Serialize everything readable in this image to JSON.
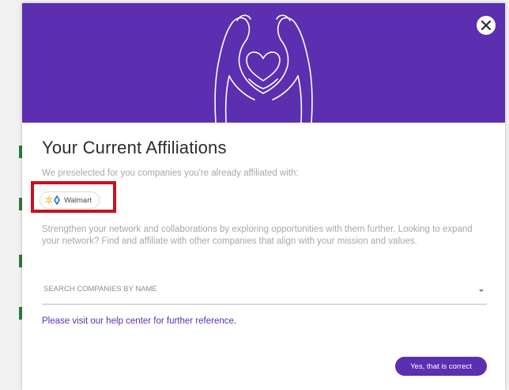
{
  "modal": {
    "title": "Your Current Affiliations",
    "subtitle": "We preselected for you companies you're already affiliated with:",
    "affiliations": [
      {
        "name": "Walmart",
        "logo_icon": "walmart-spark-icon",
        "brand_color": "#f7b733"
      }
    ],
    "body_text": "Strengthen your network and collaborations by exploring opportunities with them further. Looking to expand your network? Find and affiliate with other companies that align with your mission and values.",
    "search": {
      "placeholder": "SEARCH COMPANIES BY NAME",
      "value": ""
    },
    "help_link_text": "Please visit our help center for further reference.",
    "confirm_label": "Yes, that is correct",
    "close_icon": "close-icon",
    "hero_icon": "heart-hands-icon"
  },
  "colors": {
    "primary": "#5b2fb0",
    "highlight": "#c8101e",
    "muted_text": "#a8a8ad"
  }
}
